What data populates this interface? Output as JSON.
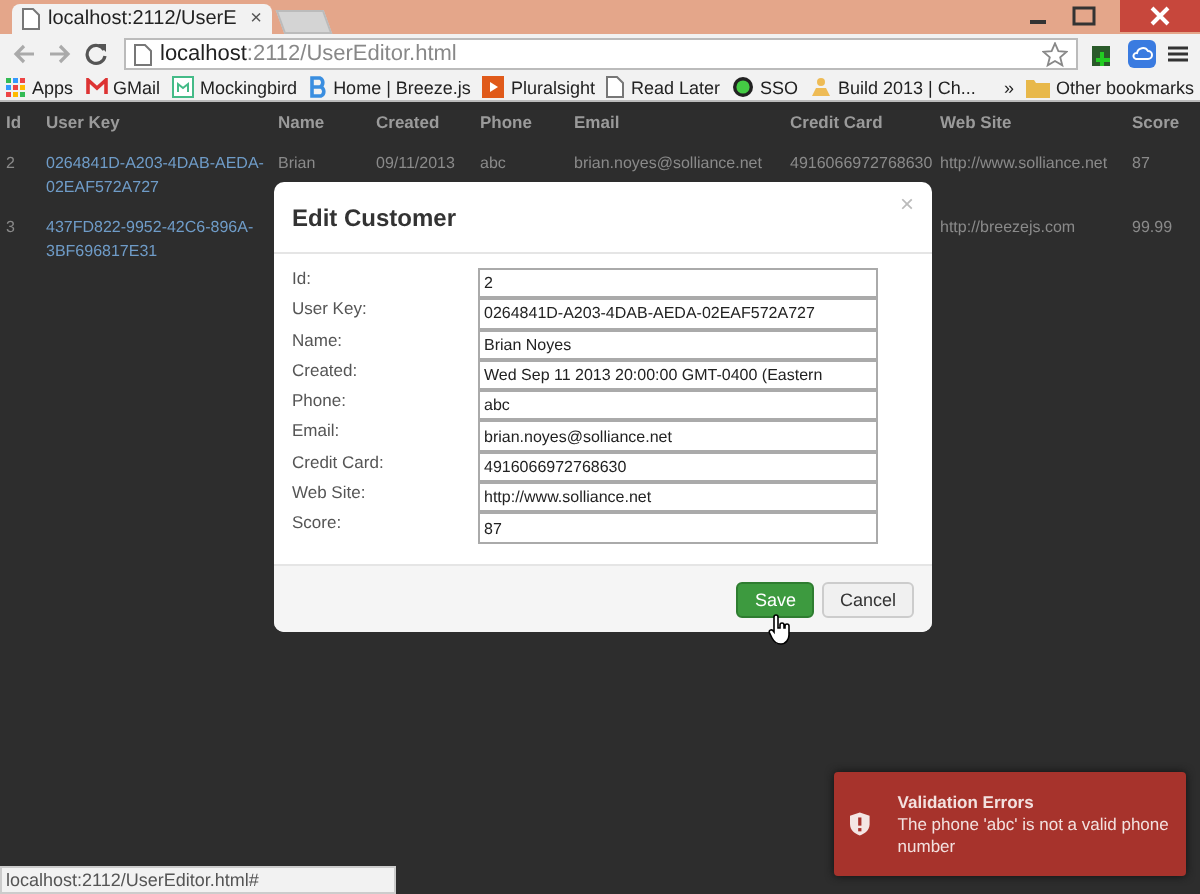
{
  "browser": {
    "tab_title": "localhost:2112/UserE",
    "tab_close": "×",
    "address_host": "localhost",
    "address_rest": ":2112/UserEditor.html",
    "bookmarks": [
      {
        "label": "Apps",
        "kind": "apps"
      },
      {
        "label": "GMail",
        "kind": "mail"
      },
      {
        "label": "Mockingbird",
        "kind": "m"
      },
      {
        "label": "Home | Breeze.js",
        "kind": "b"
      },
      {
        "label": "Pluralsight",
        "kind": "play"
      },
      {
        "label": "Read Later",
        "kind": "page"
      },
      {
        "label": "SSO",
        "kind": "lock"
      },
      {
        "label": "Build 2013 | Ch...",
        "kind": "build"
      }
    ],
    "more": "»",
    "other_bookmarks": "Other bookmarks"
  },
  "table": {
    "columns": [
      "Id",
      "User Key",
      "Name",
      "Created",
      "Phone",
      "Email",
      "Credit Card",
      "Web Site",
      "Score"
    ],
    "rows": [
      [
        "2",
        "0264841D-A203-4DAB-AEDA-02EAF572A727",
        "Brian",
        "09/11/2013",
        "abc",
        "brian.noyes@solliance.net",
        "4916066972768630",
        "http://www.solliance.net",
        "87"
      ],
      [
        "3",
        "437FD822-9952-42C6-896A-3BF696817E31",
        null,
        null,
        null,
        null,
        null,
        "http://breezejs.com",
        "99.99"
      ]
    ]
  },
  "modal": {
    "title": "Edit Customer",
    "close": "×",
    "fields": [
      {
        "label": "Id:",
        "value": "2"
      },
      {
        "label": "User Key:",
        "value": "0264841D-A203-4DAB-AEDA-02EAF572A727"
      },
      {
        "label": "Name:",
        "value": "Brian Noyes"
      },
      {
        "label": "Created:",
        "value": "Wed Sep 11 2013 20:00:00 GMT-0400 (Eastern"
      },
      {
        "label": "Phone:",
        "value": "abc"
      },
      {
        "label": "Email:",
        "value": "brian.noyes@solliance.net"
      },
      {
        "label": "Credit Card:",
        "value": "4916066972768630"
      },
      {
        "label": "Web Site:",
        "value": "http://www.solliance.net"
      },
      {
        "label": "Score:",
        "value": "87"
      }
    ],
    "buttons": [
      {
        "label": "Save",
        "kind": "primary"
      },
      {
        "label": "Cancel",
        "kind": "default"
      }
    ]
  },
  "toast": {
    "title": "Validation Errors",
    "message": "The phone 'abc' is not a valid phone number"
  },
  "status_bar": "localhost:2112/UserEditor.html#"
}
